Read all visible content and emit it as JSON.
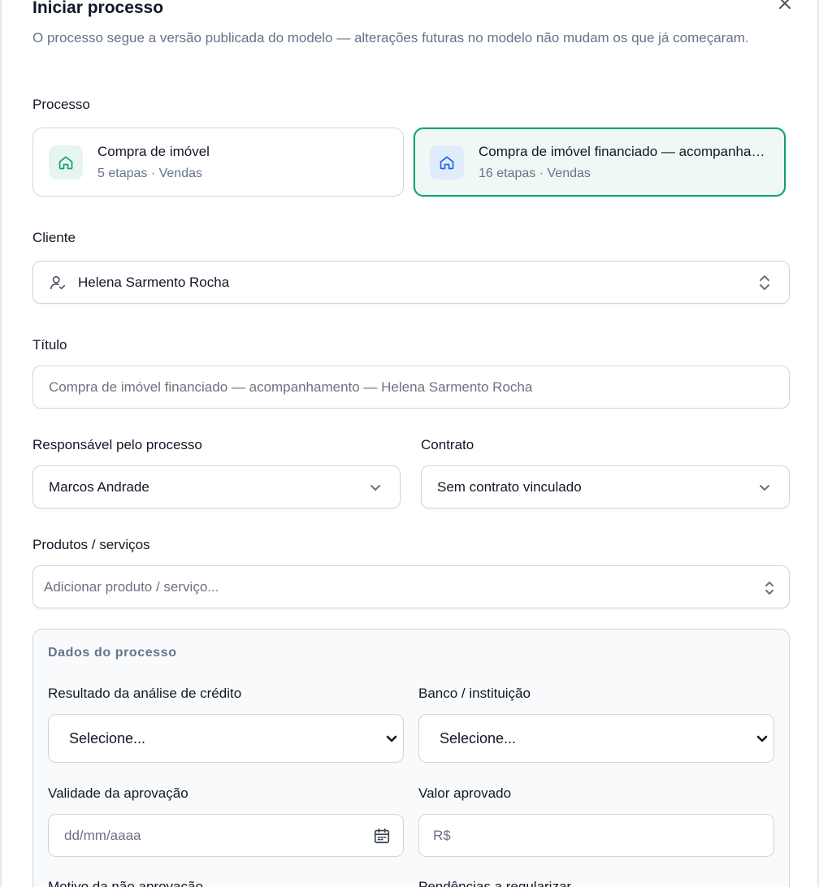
{
  "dialog": {
    "title": "Iniciar processo",
    "subtitle": "O processo segue a versão publicada do modelo — alterações futuras no modelo não mudam os que já começaram.",
    "close_icon": "close-icon"
  },
  "processo": {
    "label": "Processo",
    "options": [
      {
        "name": "Compra de imóvel",
        "meta": "5 etapas · Vendas",
        "icon": "home-icon",
        "selected": false
      },
      {
        "name": "Compra de imóvel financiado — acompanhamento",
        "meta": "16 etapas · Vendas",
        "icon": "home-icon",
        "selected": true
      }
    ]
  },
  "cliente": {
    "label": "Cliente",
    "value": "Helena Sarmento Rocha",
    "icon": "user-check-icon"
  },
  "titulo": {
    "label": "Título",
    "placeholder": "Compra de imóvel financiado — acompanhamento — Helena Sarmento Rocha"
  },
  "responsavel": {
    "label": "Responsável pelo processo",
    "value": "Marcos Andrade"
  },
  "contrato": {
    "label": "Contrato",
    "value": "Sem contrato vinculado"
  },
  "produtos": {
    "label": "Produtos / serviços",
    "placeholder": "Adicionar produto / serviço..."
  },
  "dados": {
    "title": "Dados do processo",
    "credito": {
      "label": "Resultado da análise de crédito",
      "value": "Selecione..."
    },
    "banco": {
      "label": "Banco / instituição",
      "value": "Selecione..."
    },
    "validade": {
      "label": "Validade da aprovação",
      "placeholder": "dd/mm/aaaa"
    },
    "valor": {
      "label": "Valor aprovado",
      "placeholder": "R$"
    },
    "motivo": {
      "label": "Motivo da não aprovação"
    },
    "pendencias": {
      "label": "Pendências a regularizar"
    }
  },
  "colors": {
    "accent": "#10a36e",
    "selected_bg": "#f0f8f5",
    "green_icon_bg": "#e6f6ef",
    "blue_icon_bg": "#e0ebfb",
    "blue_icon": "#2563eb"
  }
}
